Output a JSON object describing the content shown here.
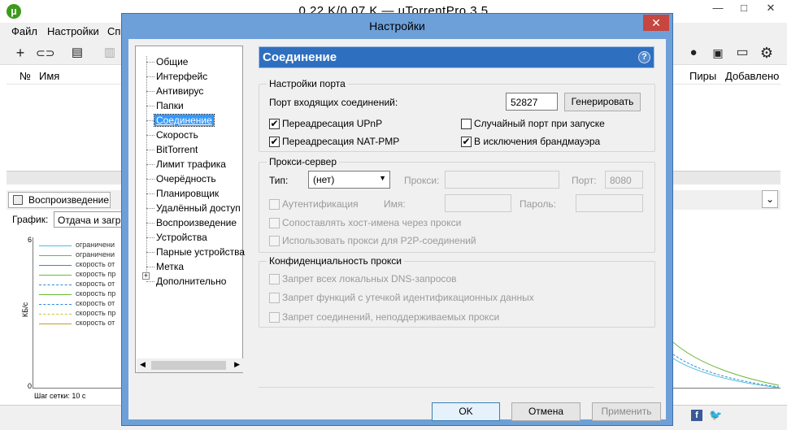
{
  "window": {
    "title": "0.22 K/0.07 K — uTorrentPro 3.5",
    "minimize": "—",
    "restore": "□",
    "close": "✕"
  },
  "menu": {
    "file": "Файл",
    "settings": "Настройки",
    "help_partial": "Сп"
  },
  "list_header": {
    "num": "№",
    "name": "Имя",
    "peers": "Пиры",
    "added": "Добавлено"
  },
  "bottom_tabs": {
    "playback": "Воспроизведение"
  },
  "graph": {
    "label": "График:",
    "select": "Отдача и загр",
    "ymax": "6",
    "ymin": "0",
    "ylabel": "КБ/с",
    "grid_step": "Шаг сетки: 10 с",
    "legend": [
      "ограничени",
      "ограничени",
      "скорость от",
      "скорость пр",
      "скорость от",
      "скорость пр",
      "скорость от",
      "скорость пр",
      "скорость от"
    ]
  },
  "dialog": {
    "title": "Настройки",
    "close": "✕",
    "tree": [
      "Общие",
      "Интерфейс",
      "Антивирус",
      "Папки",
      "Соединение",
      "Скорость",
      "BitTorrent",
      "Лимит трафика",
      "Очерёдность",
      "Планировщик",
      "Удалённый доступ",
      "Воспроизведение",
      "Устройства",
      "Парные устройства",
      "Метка",
      "Дополнительно"
    ],
    "tree_expander": "+",
    "panel_title": "Соединение",
    "help": "?",
    "port_group": {
      "title": "Настройки порта",
      "incoming_port_label": "Порт входящих соединений:",
      "incoming_port": "52827",
      "generate": "Генерировать",
      "upnp": "Переадресация UPnP",
      "natpmp": "Переадресация NAT-PMP",
      "random_port": "Случайный порт при запуске",
      "firewall": "В исключения брандмауэра"
    },
    "proxy_group": {
      "title": "Прокси-сервер",
      "type_label": "Тип:",
      "type_value": "(нет)",
      "proxy_label": "Прокси:",
      "proxy_value": "",
      "port_label": "Порт:",
      "port_value": "8080",
      "auth": "Аутентификация",
      "name_label": "Имя:",
      "password_label": "Пароль:",
      "resolve_hosts": "Сопоставлять хост-имена через прокси",
      "p2p": "Использовать прокси для P2P-соединений"
    },
    "privacy_group": {
      "title": "Конфиденциальность прокси",
      "dns": "Запрет всех локальных DNS-запросов",
      "leak": "Запрет функций с утечкой идентификационных данных",
      "unsupported": "Запрет соединений, неподдерживаемых прокси"
    },
    "buttons": {
      "ok": "OK",
      "cancel": "Отмена",
      "apply": "Применить"
    }
  },
  "checks": {
    "upnp": true,
    "natpmp": true,
    "random_port": false,
    "firewall": true
  }
}
